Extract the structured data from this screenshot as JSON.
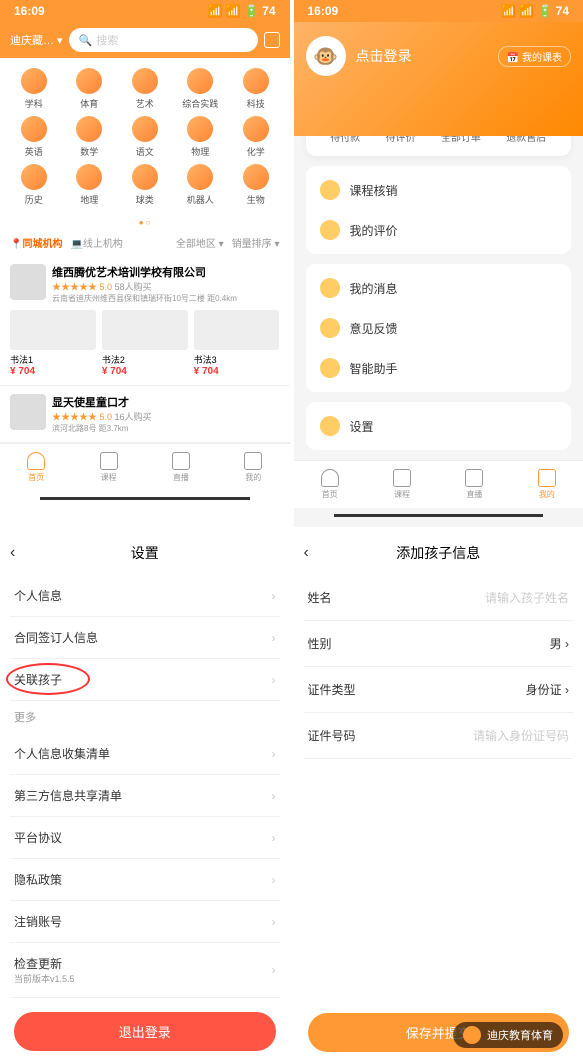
{
  "status": {
    "time": "16:09",
    "battery": "74"
  },
  "home": {
    "location": "迪庆藏…",
    "search_placeholder": "搜索",
    "categories": [
      "学科",
      "体育",
      "艺术",
      "综合实践",
      "科技",
      "英语",
      "数学",
      "语文",
      "物理",
      "化学",
      "历史",
      "地理",
      "球类",
      "机器人",
      "生物"
    ],
    "filters": {
      "local": "同城机构",
      "online": "线上机构",
      "region": "全部地区",
      "sort": "销量排序"
    },
    "listing1": {
      "title": "维西腾优艺术培训学校有限公司",
      "rating": "★★★★★ 5.0",
      "buyers": "58人购买",
      "address": "云南省迪庆州维西县保和镇瑞环街10号二楼",
      "distance": "距0.4km",
      "courses": [
        {
          "name": "书法1",
          "price": "¥ 704"
        },
        {
          "name": "书法2",
          "price": "¥ 704"
        },
        {
          "name": "书法3",
          "price": "¥ 704"
        }
      ]
    },
    "listing2": {
      "title": "显天使星童口才",
      "rating": "★★★★★ 5.0",
      "buyers": "16人购买",
      "address": "滨河北路8号",
      "distance": "距3.7km"
    },
    "tabs": [
      "首页",
      "课程",
      "直播",
      "我的"
    ]
  },
  "profile": {
    "login": "点击登录",
    "my_courses": "我的课表",
    "orders": [
      "待付款",
      "待评价",
      "全部订单",
      "退款售后"
    ],
    "menu1": [
      "课程核销",
      "我的评价"
    ],
    "menu2": [
      "我的消息",
      "意见反馈",
      "智能助手"
    ],
    "menu3": [
      "设置"
    ],
    "tabs": [
      "首页",
      "课程",
      "直播",
      "我的"
    ]
  },
  "settings": {
    "title": "设置",
    "items": [
      "个人信息",
      "合同签订人信息",
      "关联孩子"
    ],
    "more": "更多",
    "items2": [
      "个人信息收集清单",
      "第三方信息共享清单",
      "平台协议",
      "隐私政策",
      "注销账号"
    ],
    "update": "检查更新",
    "version": "当前版本v1.5.5",
    "logout": "退出登录"
  },
  "add_child": {
    "title": "添加孩子信息",
    "fields": {
      "name_label": "姓名",
      "name_ph": "请输入孩子姓名",
      "gender_label": "性别",
      "gender_value": "男",
      "idtype_label": "证件类型",
      "idtype_value": "身份证",
      "idnum_label": "证件号码",
      "idnum_ph": "请输入身份证号码"
    },
    "submit": "保存并提交"
  },
  "float": {
    "name": "迪庆教育体育"
  }
}
